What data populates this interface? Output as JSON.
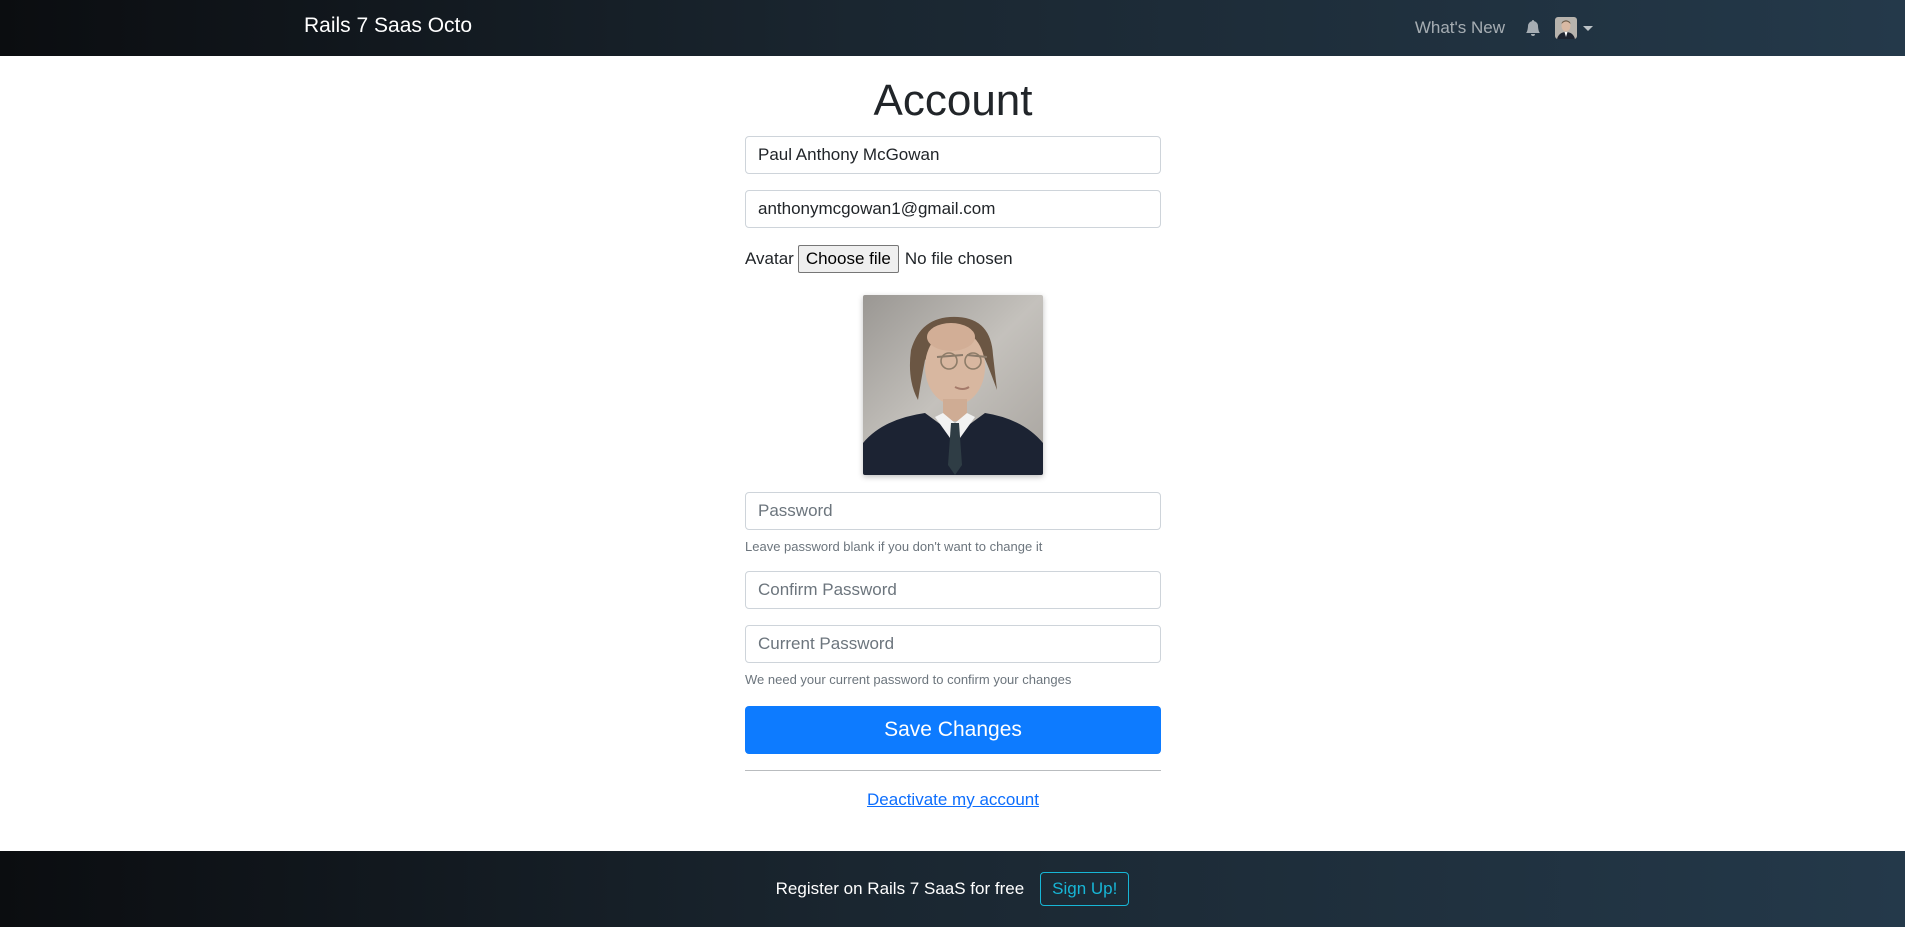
{
  "navbar": {
    "brand": "Rails 7 Saas Octo",
    "whats_new": "What's New",
    "icons": [
      "bell-icon",
      "user-avatar",
      "chevron-down-icon"
    ]
  },
  "form": {
    "title": "Account",
    "name_value": "Paul Anthony McGowan",
    "email_value": "anthonymcgowan1@gmail.com",
    "avatar_label": "Avatar",
    "choose_file_label": "Choose file",
    "file_status": "No file chosen",
    "password_placeholder": "Password",
    "password_hint": "Leave password blank if you don't want to change it",
    "confirm_password_placeholder": "Confirm Password",
    "current_password_placeholder": "Current Password",
    "current_password_hint": "We need your current password to confirm your changes",
    "save_label": "Save Changes",
    "deactivate_label": "Deactivate my account"
  },
  "footer": {
    "text": "Register on Rails 7 SaaS for free",
    "signup_label": "Sign Up!"
  },
  "colors": {
    "primary": "#0d7bff",
    "info": "#17b6d6",
    "navbar_dark": "#0b0d10",
    "navbar_light": "#24394a"
  }
}
